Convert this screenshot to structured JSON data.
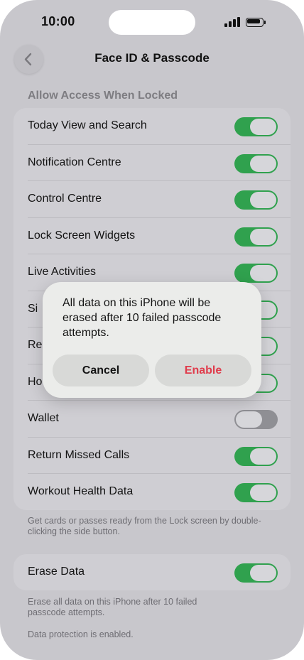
{
  "status_bar": {
    "time": "10:00"
  },
  "nav": {
    "title": "Face ID & Passcode",
    "back_icon": "chevron-left-icon"
  },
  "allow_access": {
    "header": "Allow Access When Locked",
    "items": [
      {
        "label": "Today View and Search",
        "on": true
      },
      {
        "label": "Notification Centre",
        "on": true
      },
      {
        "label": "Control Centre",
        "on": true
      },
      {
        "label": "Lock Screen Widgets",
        "on": true
      },
      {
        "label": "Live Activities",
        "on": true
      },
      {
        "label": "Si",
        "on": true
      },
      {
        "label": "Re",
        "on": true
      },
      {
        "label": "Ho",
        "on": true
      },
      {
        "label": "Wallet",
        "on": false
      },
      {
        "label": "Return Missed Calls",
        "on": true
      },
      {
        "label": "Workout Health Data",
        "on": true
      }
    ],
    "footer": "Get cards or passes ready from the Lock screen by double-clicking the side button."
  },
  "erase": {
    "label": "Erase Data",
    "on": true,
    "footer": "Erase all data on this iPhone after 10 failed passcode attempts.",
    "protection_note": "Data protection is enabled."
  },
  "dialog": {
    "message": "All data on this iPhone will be erased after 10 failed passcode attempts.",
    "cancel_label": "Cancel",
    "enable_label": "Enable"
  },
  "colors": {
    "toggle_on": "#30a14e",
    "toggle_off": "#8f8f94",
    "destructive": "#e03c4c"
  }
}
